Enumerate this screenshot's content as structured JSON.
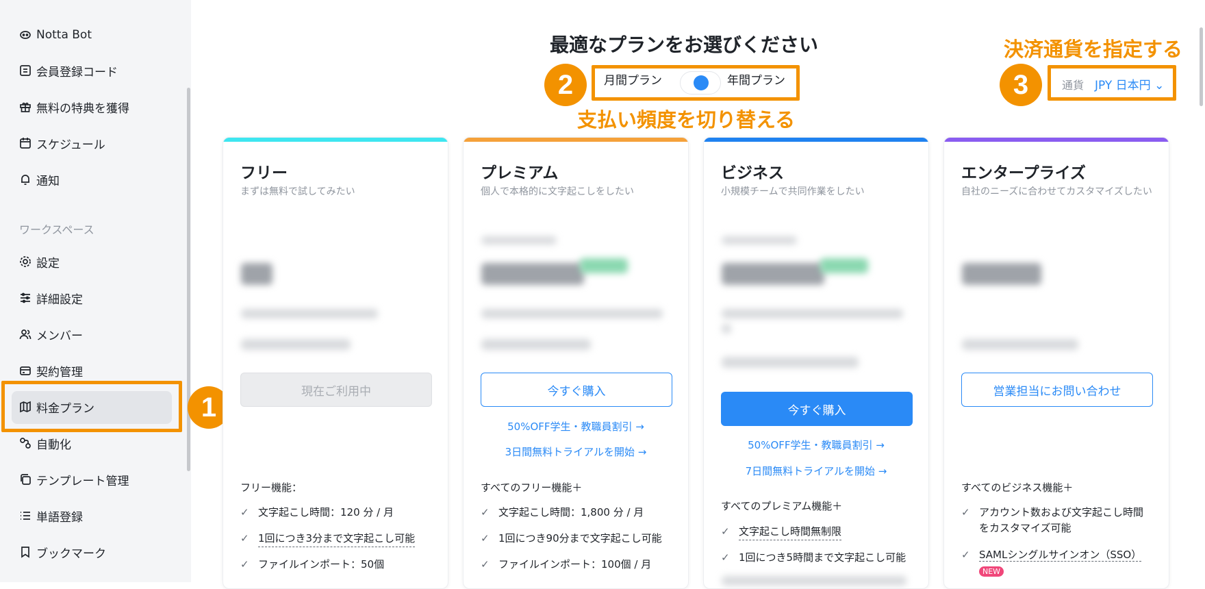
{
  "sidebar": {
    "items": [
      {
        "label": "Notta Bot",
        "icon": "bot-icon"
      },
      {
        "label": "会員登録コード",
        "icon": "code-icon"
      },
      {
        "label": "無料の特典を獲得",
        "icon": "gift-icon"
      },
      {
        "label": "スケジュール",
        "icon": "calendar-icon"
      },
      {
        "label": "通知",
        "icon": "bell-icon"
      }
    ],
    "section_label": "ワークスペース",
    "workspace_items": [
      {
        "label": "設定",
        "icon": "gear-icon"
      },
      {
        "label": "詳細設定",
        "icon": "sliders-icon"
      },
      {
        "label": "メンバー",
        "icon": "users-icon"
      },
      {
        "label": "契約管理",
        "icon": "card-icon"
      },
      {
        "label": "料金プラン",
        "icon": "map-icon",
        "active": true
      },
      {
        "label": "自動化",
        "icon": "automation-icon"
      },
      {
        "label": "テンプレート管理",
        "icon": "template-icon"
      },
      {
        "label": "単語登録",
        "icon": "list-icon"
      },
      {
        "label": "ブックマーク",
        "icon": "bookmark-icon"
      }
    ]
  },
  "header": {
    "title": "最適なプランをお選びください",
    "monthly_label": "月間プラン",
    "yearly_label": "年間プラン",
    "currency_label": "通貨",
    "currency_value": "JPY 日本円"
  },
  "annotations": {
    "badge1": "1",
    "badge2": "2",
    "badge3": "3",
    "text2": "支払い頻度を切り替える",
    "text3": "決済通貨を指定する"
  },
  "plans": [
    {
      "name": "フリー",
      "desc": "まずは無料で試してみたい",
      "color": "#3ee6f0",
      "button": "現在ご利用中",
      "feature_head": "フリー機能：",
      "features": [
        "文字起こし時間：120 分 / 月",
        "1回につき3分まで文字起こし可能",
        "ファイルインポート：50個"
      ]
    },
    {
      "name": "プレミアム",
      "desc": "個人で本格的に文字起こしをしたい",
      "color": "#f5a13a",
      "button": "今すぐ購入",
      "link1": "50%OFF学生・教職員割引 →",
      "link2": "3日間無料トライアルを開始 →",
      "feature_head": "すべてのフリー機能＋",
      "features": [
        "文字起こし時間：1,800 分 / 月",
        "1回につき90分まで文字起こし可能",
        "ファイルインポート：100個 / 月"
      ]
    },
    {
      "name": "ビジネス",
      "desc": "小規模チームで共同作業をしたい",
      "color": "#1f82f0",
      "button": "今すぐ購入",
      "link1": "50%OFF学生・教職員割引 →",
      "link2": "7日間無料トライアルを開始 →",
      "feature_head": "すべてのプレミアム機能＋",
      "features": [
        "文字起こし時間無制限",
        "1回につき5時間まで文字起こし可能"
      ]
    },
    {
      "name": "エンタープライズ",
      "desc": "自社のニーズに合わせてカスタマイズしたい",
      "color": "#8a5cf0",
      "button": "営業担当にお問い合わせ",
      "feature_head": "すべてのビジネス機能＋",
      "features": [
        "アカウント数および文字起こし時間をカスタマイズ可能",
        "SAMLシングルサインオン（SSO）"
      ],
      "new_badge": "NEW"
    }
  ]
}
